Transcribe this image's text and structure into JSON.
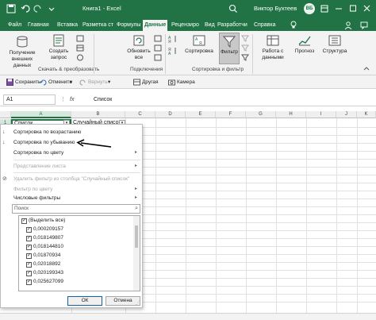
{
  "titlebar": {
    "autosave_label": "",
    "document_title": "Книга1  -  Excel",
    "user_name": "Виктор Бухтеев",
    "avatar_initials": "ВБ",
    "accent_color": "#217346"
  },
  "tabs": [
    "Файл",
    "Главная",
    "Вставка",
    "Разметка ст",
    "Формулы",
    "Данные",
    "Рецензиро",
    "Вид",
    "Разработчи",
    "Справка"
  ],
  "ribbon": {
    "get_data_label": "Получение внешних данных",
    "create_query_label": "Создать запрос",
    "refresh_all_label": "Обновить все",
    "sort_label": "Сортировка",
    "filter_label": "Фильтр",
    "data_tools_label": "Работа с данными",
    "forecast_label": "Прогноз",
    "structure_label": "Структура",
    "group_download": "Скачать & преобразовать",
    "group_connections": "Подключения",
    "group_sort_filter": "Сортировка и фильтр"
  },
  "qat": {
    "save_label": "Сохранить",
    "undo_label": "Отменить",
    "redo_label": "Вернуть",
    "other_label": "Другая",
    "camera_label": "Камера"
  },
  "formula_bar": {
    "name_box": "A1",
    "fx": "fx",
    "value": "Список"
  },
  "grid": {
    "columns": [
      "A",
      "B",
      "C",
      "D",
      "E",
      "F",
      "G",
      "H",
      "I",
      "J",
      "K"
    ],
    "rows": [
      "1"
    ],
    "a1": "Список",
    "b1": "Случайный список"
  },
  "dropdown": {
    "sort_asc": "Сортировка по возрастанию",
    "sort_desc": "Сортировка по убыванию",
    "sort_color": "Сортировка по цвету",
    "sheet_view": "Представление листа",
    "clear_filter": "Удалить фильтр из столбца \"Случайный список\"",
    "filter_color": "Фильтр по цвету",
    "number_filters": "Числовые фильтры",
    "search_placeholder": "Поиск",
    "items": [
      "(Выделить все)",
      "0,000209157",
      "0,018149807",
      "0,018144810",
      "0,01870934",
      "0,02018892",
      "0,020199343",
      "0,025627099"
    ],
    "ok_label": "ОК",
    "cancel_label": "Отмена"
  }
}
